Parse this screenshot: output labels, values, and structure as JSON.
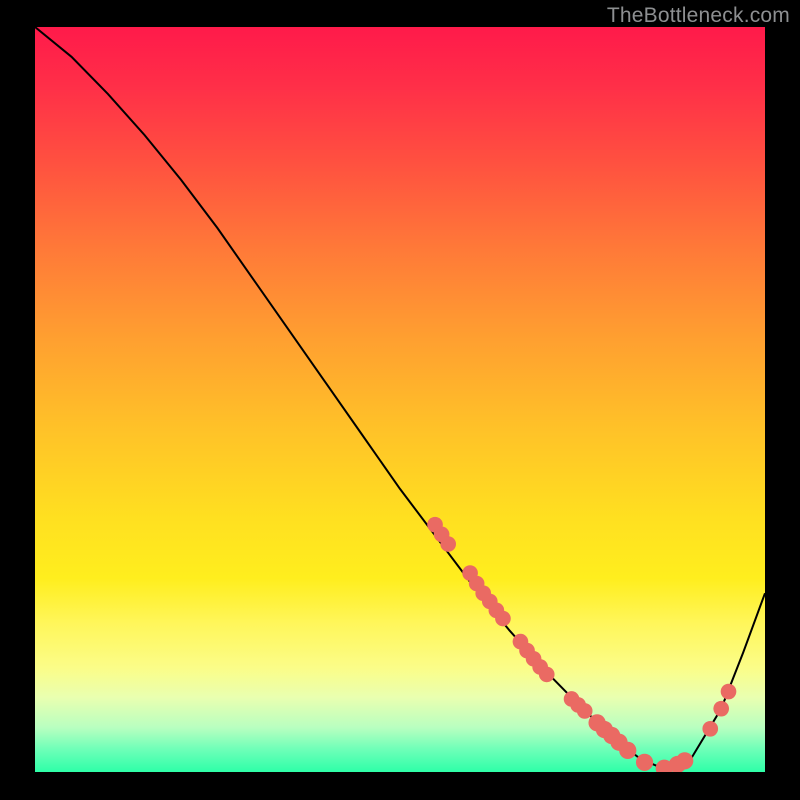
{
  "watermark": "TheBottleneck.com",
  "chart_data": {
    "type": "line",
    "title": "",
    "xlabel": "",
    "ylabel": "",
    "xlim": [
      0,
      100
    ],
    "ylim": [
      0,
      100
    ],
    "grid": false,
    "legend": false,
    "series": [
      {
        "name": "curve",
        "color": "#000000",
        "x": [
          0,
          5,
          10,
          15,
          20,
          25,
          30,
          35,
          40,
          45,
          50,
          55,
          60,
          65,
          70,
          75,
          80,
          83,
          86,
          90,
          94,
          97,
          100
        ],
        "y": [
          100,
          96,
          91,
          85.5,
          79.5,
          73,
          66,
          59,
          52,
          45,
          38,
          31.5,
          25,
          19,
          13.5,
          8.5,
          4.0,
          1.7,
          0.5,
          2.0,
          8.5,
          16,
          24
        ]
      }
    ],
    "markers": [
      {
        "x": 54.8,
        "y": 33.2,
        "r": 1.2
      },
      {
        "x": 55.7,
        "y": 31.9,
        "r": 1.2
      },
      {
        "x": 56.6,
        "y": 30.6,
        "r": 1.2
      },
      {
        "x": 59.6,
        "y": 26.7,
        "r": 1.2
      },
      {
        "x": 60.5,
        "y": 25.3,
        "r": 1.2
      },
      {
        "x": 61.4,
        "y": 24.0,
        "r": 1.2
      },
      {
        "x": 62.3,
        "y": 22.9,
        "r": 1.2
      },
      {
        "x": 63.2,
        "y": 21.7,
        "r": 1.2
      },
      {
        "x": 64.1,
        "y": 20.6,
        "r": 1.2
      },
      {
        "x": 66.5,
        "y": 17.5,
        "r": 1.2
      },
      {
        "x": 67.4,
        "y": 16.3,
        "r": 1.2
      },
      {
        "x": 68.3,
        "y": 15.2,
        "r": 1.2
      },
      {
        "x": 69.2,
        "y": 14.1,
        "r": 1.2
      },
      {
        "x": 70.1,
        "y": 13.1,
        "r": 1.2
      },
      {
        "x": 73.5,
        "y": 9.8,
        "r": 1.2
      },
      {
        "x": 74.4,
        "y": 9.0,
        "r": 1.2
      },
      {
        "x": 75.3,
        "y": 8.2,
        "r": 1.2
      },
      {
        "x": 77.0,
        "y": 6.6,
        "r": 1.4
      },
      {
        "x": 78.0,
        "y": 5.7,
        "r": 1.4
      },
      {
        "x": 79.0,
        "y": 4.9,
        "r": 1.4
      },
      {
        "x": 80.0,
        "y": 4.0,
        "r": 1.4
      },
      {
        "x": 81.2,
        "y": 2.9,
        "r": 1.4
      },
      {
        "x": 83.5,
        "y": 1.3,
        "r": 1.4
      },
      {
        "x": 86.2,
        "y": 0.5,
        "r": 1.4
      },
      {
        "x": 88.0,
        "y": 1.0,
        "r": 1.4
      },
      {
        "x": 89.0,
        "y": 1.5,
        "r": 1.4
      },
      {
        "x": 92.5,
        "y": 5.8,
        "r": 1.2
      },
      {
        "x": 94.0,
        "y": 8.5,
        "r": 1.2
      },
      {
        "x": 95.0,
        "y": 10.8,
        "r": 1.2
      }
    ],
    "marker_color": "#ea6a63"
  }
}
